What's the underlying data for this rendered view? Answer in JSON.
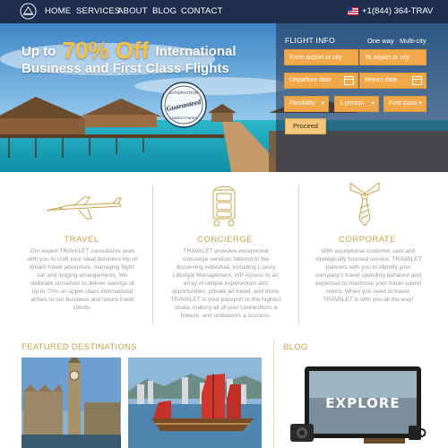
{
  "nav": {
    "items": [
      "HOME",
      "SERVICES",
      "ABOUT",
      "BLOG",
      "CONTACT"
    ],
    "phone": "+1(844) 364-TRAV"
  },
  "hero": {
    "line1_pre": "Up to",
    "line1_pct": "70% Off",
    "line1_post": "International",
    "line2": "Business and First Class Flights",
    "badge_top": "SATISFACTION",
    "badge_mid": "Guaranteed",
    "badge_bottom": "LOWEST FARES"
  },
  "flight": {
    "title": "FLIGHT INFO",
    "one_way": "One way",
    "multi_city": "Multi-city",
    "from_placeholder": "From airport or city",
    "to_placeholder": "To airport or city",
    "departure_placeholder": "Departure date",
    "return_placeholder": "Return date",
    "flexibility": "Flexibility",
    "persons": "1 person",
    "class": "First class",
    "proceed": "Proceed"
  },
  "services": [
    {
      "title": "TRAVEL",
      "text": "Our expert TRAVALET consultants work with you to craft your ideal business trip or dream travel adventure, managing flight, car and lodging arrangements. We dedicate ourselves to deliver savings of up to 70% on upper-class international airfare to our business and luxury travel clients."
    },
    {
      "title": "CONCIERGE",
      "text": "TRAVALET provides exceptional concierge services tailored to the discerning individual, including Luxury Lifestyle Management, VIP Access to an array of unique experiences and opportunities, private jet travel, and more. TRAVALET is your passport to the highest strata, making all of your connections a breeze, and endeavors a success."
    },
    {
      "title": "CORPORATE",
      "text": "With exceptional customer care and strategically focused service, TRAVALET partners with you to identify your company's travel spending behavior and expenses to maximize your travel-spend return. When you need to travel, TRAVALET is with you all the way!"
    }
  ],
  "featured": {
    "title": "FEATURED DESTINATIONS"
  },
  "blog": {
    "title": "BLOG",
    "explore": "EXPLORE"
  },
  "colors": {
    "nav_bg": "#1e2e4e",
    "gold": "#c9a24f",
    "orange_field": "#f0a84a"
  }
}
